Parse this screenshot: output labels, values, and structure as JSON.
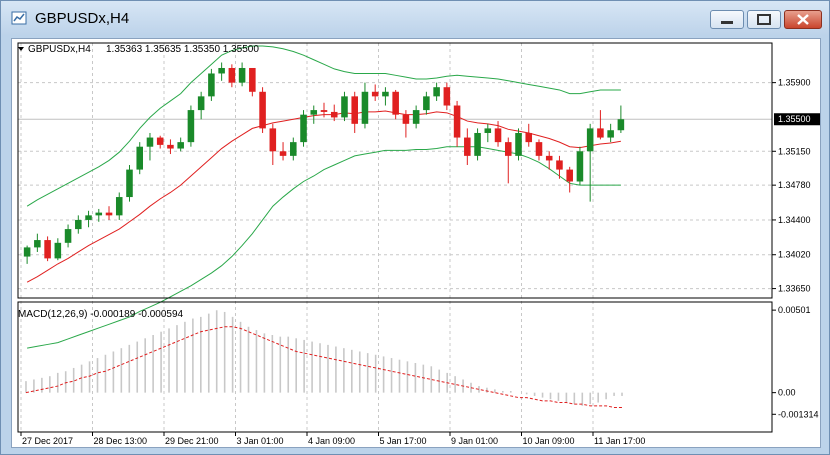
{
  "window": {
    "title": "GBPUSDx,H4"
  },
  "header": {
    "symbol": "GBPUSDx,H4",
    "ohlc": "1.35363 1.35635 1.35350 1.35500"
  },
  "macd_label": "MACD(12,26,9) -0.000189 -0.000594",
  "icons": {
    "app": "chart-window-icon",
    "minimize": "minimize-icon",
    "maximize": "maximize-icon",
    "close": "close-icon",
    "dropdown": "triangle-down-icon"
  },
  "colors": {
    "bull": "#1a8a2a",
    "bear": "#e02020",
    "ma": "#e02020",
    "bands": "#2aa84a",
    "price_line": "#c0c0c0",
    "macd_hist": "#c8c8c8",
    "macd_signal": "#e02020",
    "grid": "#c8c8c8"
  },
  "chart_data": {
    "type": "candlestick",
    "symbol": "GBPUSDx",
    "timeframe": "H4",
    "current_price": "1.35500",
    "y_ticks": [
      "1.35900",
      "1.35150",
      "1.34780",
      "1.34400",
      "1.34020",
      "1.33650"
    ],
    "y_tick_values": [
      1.359,
      1.3515,
      1.3478,
      1.344,
      1.3402,
      1.3365
    ],
    "price_range": [
      1.3358,
      1.3618
    ],
    "x_labels": [
      "27 Dec 2017",
      "28 Dec 13:00",
      "29 Dec 21:00",
      "3 Jan 01:00",
      "4 Jan 09:00",
      "5 Jan 17:00",
      "9 Jan 01:00",
      "10 Jan 09:00",
      "11 Jan 17:00"
    ],
    "grid": true,
    "macd": {
      "params": "12,26,9",
      "y_ticks": [
        "0.00501",
        "0.00",
        "-0.001314"
      ],
      "y_tick_values": [
        0.00501,
        0.0,
        -0.001314
      ],
      "range": [
        -0.0016,
        0.0052
      ],
      "main": [
        0.0007,
        0.0008,
        0.0009,
        0.001,
        0.0012,
        0.0013,
        0.0015,
        0.0017,
        0.0019,
        0.0021,
        0.0023,
        0.0025,
        0.0027,
        0.0029,
        0.0031,
        0.0033,
        0.0035,
        0.0037,
        0.0039,
        0.0041,
        0.0043,
        0.0045,
        0.0046,
        0.0048,
        0.005,
        0.0049,
        0.0046,
        0.0043,
        0.004,
        0.0038,
        0.0036,
        0.0035,
        0.0034,
        0.0034,
        0.0033,
        0.0032,
        0.0031,
        0.003,
        0.0029,
        0.0028,
        0.0027,
        0.0026,
        0.0025,
        0.0024,
        0.0023,
        0.0022,
        0.0021,
        0.002,
        0.0019,
        0.0018,
        0.0017,
        0.0016,
        0.0014,
        0.0012,
        0.001,
        0.0008,
        0.0006,
        0.0004,
        0.0003,
        0.0002,
        0.0001,
        0.0001,
        0.0,
        -0.0001,
        -0.0002,
        -0.0003,
        -0.0004,
        -0.0005,
        -0.0006,
        -0.0007,
        -0.0008,
        -0.0007,
        -0.0006,
        -0.0004,
        -0.0002,
        -0.0002
      ],
      "signal": [
        0.0,
        0.0001,
        0.0002,
        0.0003,
        0.0004,
        0.0006,
        0.0007,
        0.0009,
        0.001,
        0.0012,
        0.0013,
        0.0015,
        0.0017,
        0.0019,
        0.0021,
        0.0023,
        0.0025,
        0.0027,
        0.0029,
        0.0031,
        0.0033,
        0.0035,
        0.0037,
        0.0038,
        0.0039,
        0.004,
        0.004,
        0.0039,
        0.0037,
        0.0035,
        0.0033,
        0.0031,
        0.0029,
        0.0027,
        0.0025,
        0.0024,
        0.0023,
        0.0022,
        0.0021,
        0.002,
        0.0019,
        0.0018,
        0.0017,
        0.0016,
        0.0015,
        0.0014,
        0.0013,
        0.0012,
        0.0011,
        0.001,
        0.0009,
        0.0008,
        0.0007,
        0.0006,
        0.0005,
        0.0004,
        0.0003,
        0.0002,
        0.0001,
        0.0,
        -0.0001,
        -0.0002,
        -0.0003,
        -0.0003,
        -0.0004,
        -0.0005,
        -0.0005,
        -0.0006,
        -0.0006,
        -0.0007,
        -0.0007,
        -0.0008,
        -0.0008,
        -0.0008,
        -0.0009,
        -0.0009
      ]
    },
    "candles": [
      [
        1.34,
        1.3412,
        1.3392,
        1.341
      ],
      [
        1.341,
        1.3425,
        1.3405,
        1.3418
      ],
      [
        1.3418,
        1.3422,
        1.3395,
        1.3398
      ],
      [
        1.3398,
        1.342,
        1.3396,
        1.3415
      ],
      [
        1.3415,
        1.3435,
        1.341,
        1.343
      ],
      [
        1.343,
        1.3445,
        1.3425,
        1.344
      ],
      [
        1.344,
        1.345,
        1.3432,
        1.3445
      ],
      [
        1.3445,
        1.3452,
        1.3438,
        1.3448
      ],
      [
        1.3448,
        1.3455,
        1.344,
        1.3445
      ],
      [
        1.3445,
        1.347,
        1.344,
        1.3465
      ],
      [
        1.3465,
        1.35,
        1.346,
        1.3495
      ],
      [
        1.3495,
        1.3525,
        1.349,
        1.352
      ],
      [
        1.352,
        1.3535,
        1.3505,
        1.353
      ],
      [
        1.353,
        1.3532,
        1.3518,
        1.3522
      ],
      [
        1.3522,
        1.3528,
        1.3512,
        1.3518
      ],
      [
        1.3518,
        1.353,
        1.3515,
        1.3525
      ],
      [
        1.3525,
        1.3565,
        1.352,
        1.356
      ],
      [
        1.356,
        1.358,
        1.355,
        1.3575
      ],
      [
        1.3575,
        1.3605,
        1.357,
        1.36
      ],
      [
        1.36,
        1.3612,
        1.3592,
        1.3606
      ],
      [
        1.3606,
        1.361,
        1.3585,
        1.359
      ],
      [
        1.359,
        1.3612,
        1.3586,
        1.3606
      ],
      [
        1.3606,
        1.36,
        1.3575,
        1.358
      ],
      [
        1.358,
        1.3585,
        1.3535,
        1.354
      ],
      [
        1.354,
        1.3545,
        1.35,
        1.3515
      ],
      [
        1.3515,
        1.3525,
        1.3505,
        1.351
      ],
      [
        1.351,
        1.353,
        1.3505,
        1.3525
      ],
      [
        1.3525,
        1.356,
        1.352,
        1.3555
      ],
      [
        1.3555,
        1.3565,
        1.3545,
        1.356
      ],
      [
        1.356,
        1.3568,
        1.3552,
        1.3558
      ],
      [
        1.3558,
        1.3566,
        1.3548,
        1.3552
      ],
      [
        1.3552,
        1.358,
        1.3548,
        1.3575
      ],
      [
        1.3575,
        1.358,
        1.3535,
        1.3545
      ],
      [
        1.3545,
        1.359,
        1.354,
        1.358
      ],
      [
        1.358,
        1.3588,
        1.357,
        1.3575
      ],
      [
        1.3575,
        1.3585,
        1.3565,
        1.358
      ],
      [
        1.358,
        1.3582,
        1.355,
        1.3555
      ],
      [
        1.3555,
        1.356,
        1.353,
        1.3545
      ],
      [
        1.3545,
        1.3565,
        1.354,
        1.356
      ],
      [
        1.356,
        1.358,
        1.3555,
        1.3575
      ],
      [
        1.3575,
        1.359,
        1.357,
        1.3585
      ],
      [
        1.3585,
        1.359,
        1.356,
        1.3565
      ],
      [
        1.3565,
        1.357,
        1.352,
        1.353
      ],
      [
        1.353,
        1.354,
        1.35,
        1.351
      ],
      [
        1.351,
        1.354,
        1.3505,
        1.3535
      ],
      [
        1.3535,
        1.3545,
        1.3525,
        1.354
      ],
      [
        1.354,
        1.3548,
        1.352,
        1.3525
      ],
      [
        1.3525,
        1.353,
        1.348,
        1.351
      ],
      [
        1.351,
        1.354,
        1.3505,
        1.3535
      ],
      [
        1.3535,
        1.3545,
        1.352,
        1.3525
      ],
      [
        1.3525,
        1.3528,
        1.3505,
        1.351
      ],
      [
        1.351,
        1.3515,
        1.3495,
        1.3505
      ],
      [
        1.3505,
        1.351,
        1.3485,
        1.3495
      ],
      [
        1.3495,
        1.3498,
        1.347,
        1.3482
      ],
      [
        1.3482,
        1.352,
        1.3478,
        1.3515
      ],
      [
        1.3515,
        1.3545,
        1.346,
        1.354
      ],
      [
        1.354,
        1.356,
        1.3528,
        1.353
      ],
      [
        1.353,
        1.3545,
        1.3525,
        1.3538
      ],
      [
        1.3538,
        1.3565,
        1.3535,
        1.355
      ]
    ],
    "ma": [
      1.3372,
      1.3378,
      1.3385,
      1.3392,
      1.3398,
      1.3405,
      1.3412,
      1.3418,
      1.3424,
      1.343,
      1.3438,
      1.3446,
      1.3455,
      1.3463,
      1.347,
      1.3478,
      1.3488,
      1.3498,
      1.3508,
      1.3518,
      1.3526,
      1.3533,
      1.354,
      1.3543,
      1.3546,
      1.3548,
      1.355,
      1.3552,
      1.3554,
      1.3555,
      1.3555,
      1.3557,
      1.3556,
      1.3558,
      1.3558,
      1.3559,
      1.3557,
      1.3555,
      1.3555,
      1.3556,
      1.3558,
      1.3557,
      1.3553,
      1.3548,
      1.3546,
      1.3545,
      1.3543,
      1.3539,
      1.3537,
      1.3535,
      1.3532,
      1.3529,
      1.3525,
      1.352,
      1.3519,
      1.3521,
      1.3523,
      1.3524,
      1.3526
    ],
    "upper": [
      1.3455,
      1.3462,
      1.3468,
      1.3474,
      1.348,
      1.3486,
      1.3492,
      1.3498,
      1.3505,
      1.3514,
      1.3526,
      1.354,
      1.3552,
      1.3562,
      1.357,
      1.3578,
      1.359,
      1.36,
      1.361,
      1.362,
      1.3625,
      1.3628,
      1.363,
      1.363,
      1.3629,
      1.3627,
      1.3624,
      1.362,
      1.3615,
      1.361,
      1.3605,
      1.3602,
      1.36,
      1.36,
      1.36,
      1.36,
      1.3598,
      1.3596,
      1.3594,
      1.3594,
      1.3595,
      1.3597,
      1.3598,
      1.3597,
      1.3596,
      1.3595,
      1.3594,
      1.3592,
      1.359,
      1.3588,
      1.3586,
      1.3584,
      1.3582,
      1.3578,
      1.3578,
      1.358,
      1.3582,
      1.3582,
      1.3582
    ],
    "lower": [
      1.33,
      1.3302,
      1.3304,
      1.3306,
      1.331,
      1.3314,
      1.3318,
      1.3322,
      1.3326,
      1.333,
      1.3334,
      1.334,
      1.3345,
      1.335,
      1.3356,
      1.3362,
      1.3368,
      1.3375,
      1.3382,
      1.339,
      1.34,
      1.3412,
      1.3425,
      1.344,
      1.3455,
      1.3465,
      1.3474,
      1.3482,
      1.3488,
      1.3495,
      1.35,
      1.3505,
      1.351,
      1.3512,
      1.3514,
      1.3516,
      1.3516,
      1.3516,
      1.3517,
      1.3517,
      1.3518,
      1.352,
      1.352,
      1.352,
      1.352,
      1.3518,
      1.3516,
      1.3514,
      1.3512,
      1.3508,
      1.3503,
      1.3496,
      1.3488,
      1.348,
      1.3478,
      1.3478,
      1.3478,
      1.3478,
      1.3478
    ]
  }
}
